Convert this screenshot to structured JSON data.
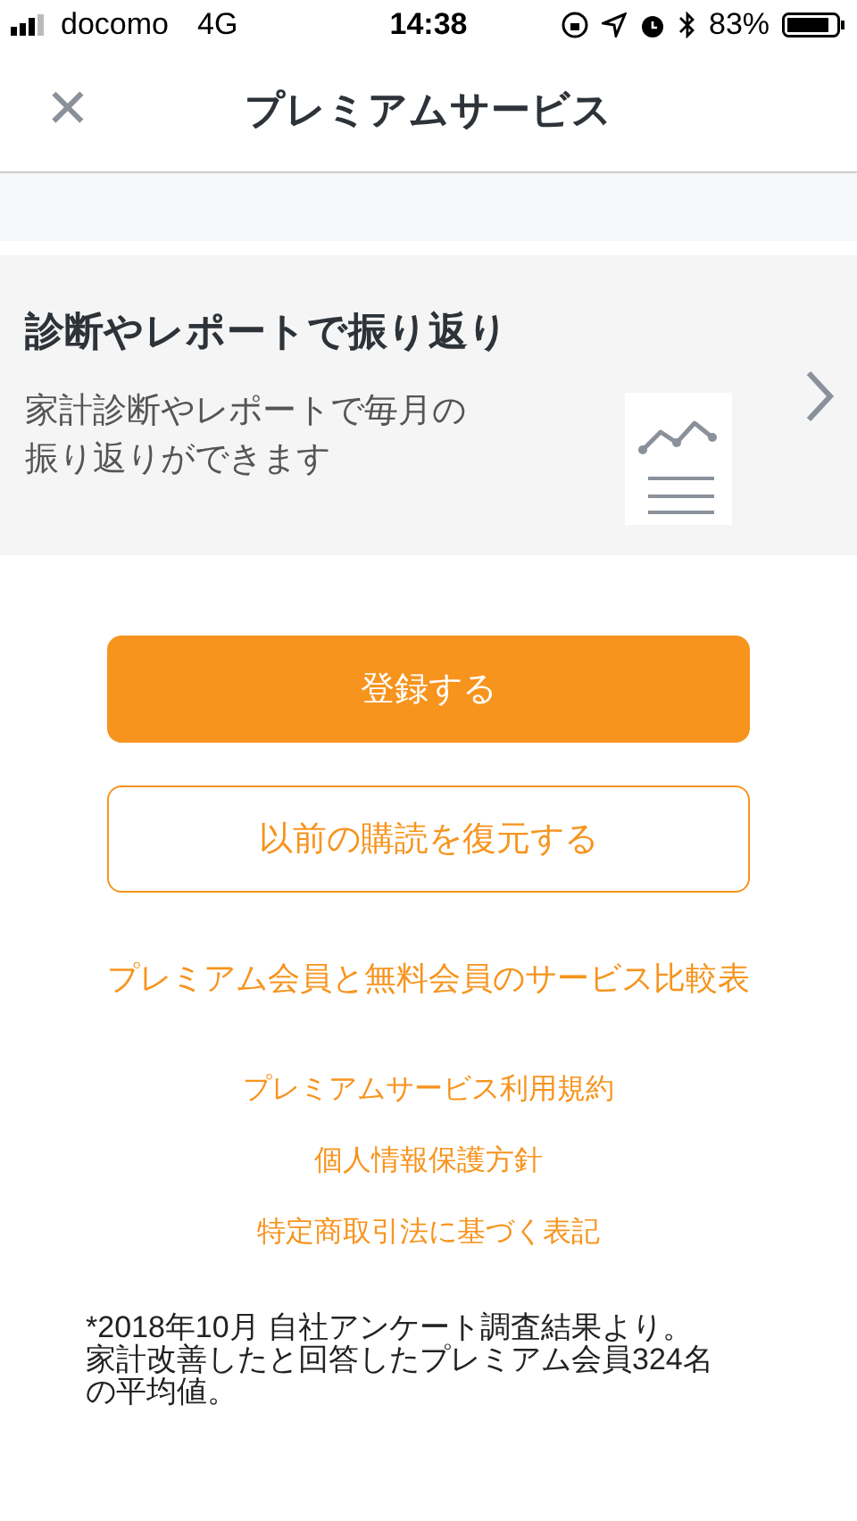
{
  "status_bar": {
    "carrier": "docomo",
    "network": "4G",
    "time": "14:38",
    "battery": "83%"
  },
  "header": {
    "close": "✕",
    "title": "プレミアムサービス"
  },
  "feature": {
    "title": "診断やレポートで振り返り",
    "description": [
      "家計診断やレポートで毎月の",
      "振り返りができます"
    ]
  },
  "buttons": [
    {
      "label": "登録する",
      "kind": "primary"
    },
    {
      "label": "以前の購読を復元する",
      "kind": "outline"
    }
  ],
  "comparison_link": "プレミアム会員と無料会員のサービス比較表",
  "links": [
    "プレミアムサービス利用規約",
    "個人情報保護方針",
    "特定商取引法に基づく表記"
  ],
  "footnote": [
    "*2018年10月 自社アンケート調査結果より。",
    "家計改善したと回答したプレミアム会員324名",
    "の平均値。"
  ]
}
